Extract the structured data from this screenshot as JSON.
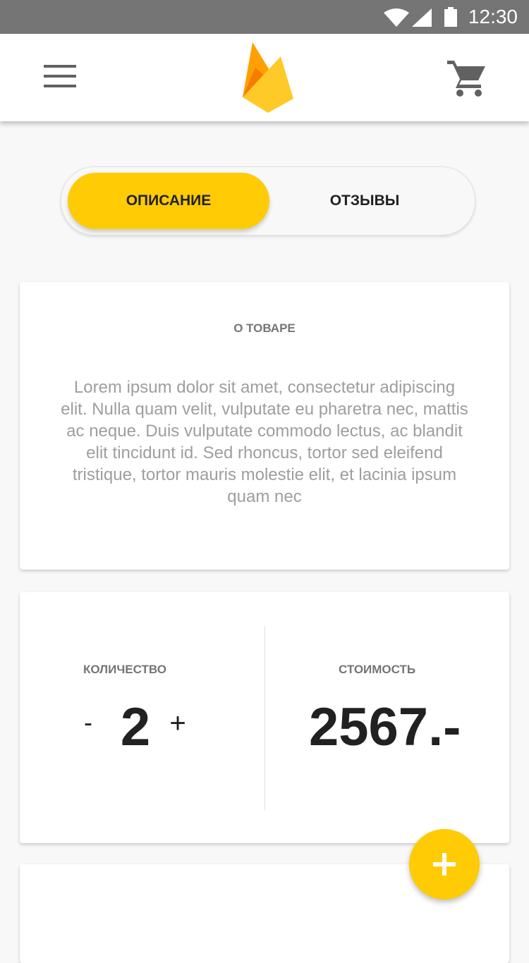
{
  "status_bar": {
    "time": "12:30",
    "icons": [
      "wifi-icon",
      "signal-icon",
      "battery-icon"
    ],
    "background": "#757575"
  },
  "app_bar": {
    "menu_icon": "hamburger-menu-icon",
    "logo_icon": "firebase-flame-logo",
    "cart_icon": "shopping-cart-icon"
  },
  "tabs": [
    {
      "label": "ОПИСАНИЕ",
      "selected": true
    },
    {
      "label": "ОТЗЫВЫ",
      "selected": false
    }
  ],
  "about_card": {
    "title": "О ТОВАРЕ",
    "body": "Lorem ipsum dolor sit amet, consectetur adipiscing elit. Nulla quam velit, vulputate eu pharetra nec, mattis ac neque. Duis vulputate commodo lectus, ac blandit elit tincidunt id. Sed rhoncus, tortor sed eleifend tristique, tortor mauris molestie elit, et lacinia ipsum quam nec"
  },
  "order_card": {
    "quantity_label": "КОЛИЧЕСТВО",
    "minus_label": "-",
    "quantity": "2",
    "plus_label": "+",
    "price_label": "СТОИМОСТЬ",
    "price": "2567.-"
  },
  "fab": {
    "icon": "plus-icon"
  },
  "colors": {
    "accent": "#ffcb05",
    "background": "#f8f8f8",
    "text_primary": "#212121",
    "text_secondary": "#757575"
  }
}
